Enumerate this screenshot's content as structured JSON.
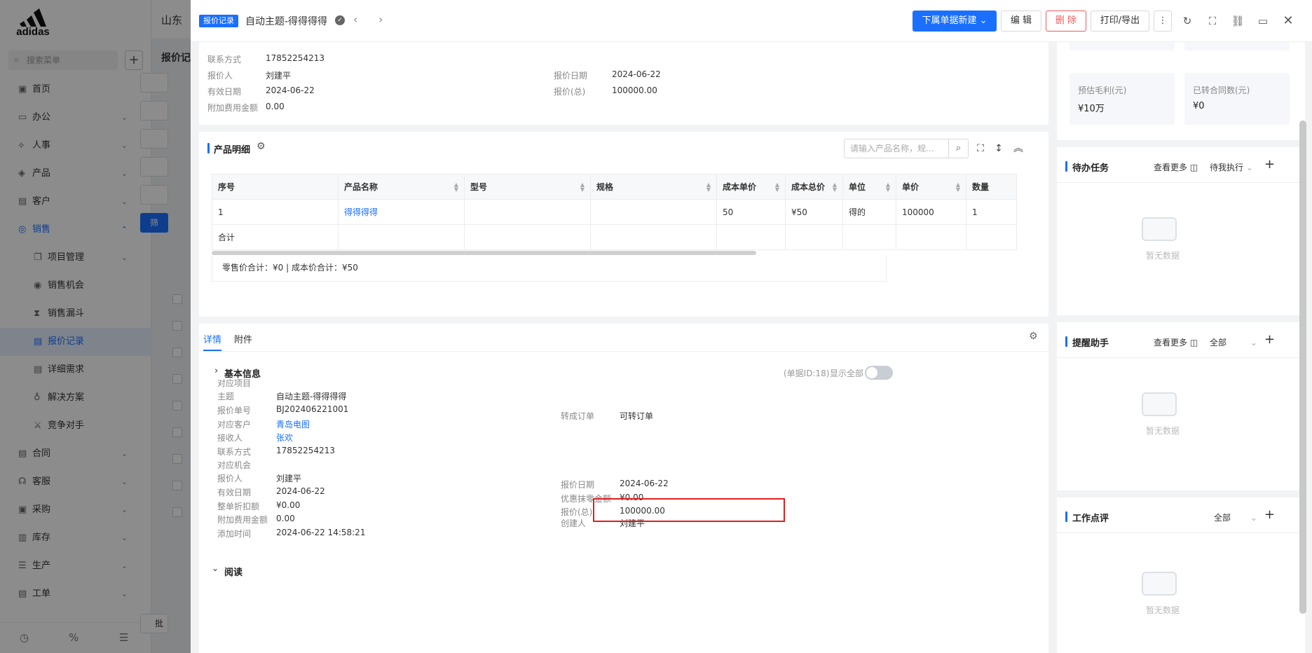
{
  "background": {
    "logo_text": "adidas",
    "search_placeholder": "搜索菜单",
    "company": "山东",
    "page_title": "报价记",
    "filter_label": "筛",
    "batch_label": "批",
    "menu": [
      {
        "label": "首页",
        "icon": "home-icon",
        "glyph": "▣",
        "chevron": ""
      },
      {
        "label": "办公",
        "icon": "office-icon",
        "glyph": "▭",
        "chevron": "⌄"
      },
      {
        "label": "人事",
        "icon": "people-icon",
        "glyph": "⟡",
        "chevron": "⌄"
      },
      {
        "label": "产品",
        "icon": "cube-icon",
        "glyph": "◈",
        "chevron": "⌄"
      },
      {
        "label": "客户",
        "icon": "customer-icon",
        "glyph": "▤",
        "chevron": "⌄"
      },
      {
        "label": "销售",
        "icon": "sales-icon",
        "glyph": "◎",
        "chevron": "⌃"
      },
      {
        "label": "项目管理",
        "icon": "project-icon",
        "glyph": "❐",
        "chevron": "⌄"
      },
      {
        "label": "销售机会",
        "icon": "opportunity-icon",
        "glyph": "◉",
        "chevron": ""
      },
      {
        "label": "销售漏斗",
        "icon": "funnel-icon",
        "glyph": "⧗",
        "chevron": ""
      },
      {
        "label": "报价记录",
        "icon": "quote-icon",
        "glyph": "▤",
        "chevron": ""
      },
      {
        "label": "详细需求",
        "icon": "requirement-icon",
        "glyph": "▤",
        "chevron": ""
      },
      {
        "label": "解决方案",
        "icon": "solution-icon",
        "glyph": "♁",
        "chevron": ""
      },
      {
        "label": "竞争对手",
        "icon": "competitor-icon",
        "glyph": "⚔",
        "chevron": ""
      },
      {
        "label": "合同",
        "icon": "contract-icon",
        "glyph": "▤",
        "chevron": "⌄"
      },
      {
        "label": "客服",
        "icon": "service-icon",
        "glyph": "☊",
        "chevron": "⌄"
      },
      {
        "label": "采购",
        "icon": "purchase-icon",
        "glyph": "▣",
        "chevron": "⌄"
      },
      {
        "label": "库存",
        "icon": "inventory-icon",
        "glyph": "▥",
        "chevron": "⌄"
      },
      {
        "label": "生产",
        "icon": "production-icon",
        "glyph": "☰",
        "chevron": "⌄"
      },
      {
        "label": "工单",
        "icon": "workorder-icon",
        "glyph": "▤",
        "chevron": "⌄"
      }
    ]
  },
  "drawer": {
    "tag": "报价记录",
    "title": "自动主题-得得得得",
    "buttons": {
      "new_sub": "下属单据新建 ⌄",
      "edit": "编 辑",
      "delete": "删 除",
      "print": "打印/导出"
    },
    "summary": {
      "contact_label": "联系方式",
      "contact_value": "17852254213",
      "quoter_label": "报价人",
      "quoter_value": "刘建平",
      "quote_date_label": "报价日期",
      "quote_date_value": "2024-06-22",
      "valid_label": "有效日期",
      "valid_value": "2024-06-22",
      "total_label": "报价(总)",
      "total_value": "100000.00",
      "extra_label": "附加费用金额",
      "extra_value": "0.00"
    },
    "products": {
      "title": "产品明细",
      "search_placeholder": "请输入产品名称，规...",
      "columns": [
        "序号",
        "产品名称",
        "型号",
        "规格",
        "成本单价",
        "成本总价",
        "单位",
        "单价",
        "数量"
      ],
      "rows": [
        [
          "1",
          "得得得得",
          "",
          "",
          "50",
          "¥50",
          "得的",
          "100000",
          "1"
        ]
      ],
      "total_row_label": "合计",
      "footer": "零售价合计：¥0 |   成本价合计：¥50"
    },
    "detail": {
      "tabs": [
        "详情",
        "附件"
      ],
      "basic_title": "基本信息",
      "doc_id": "(单据ID:18)",
      "show_all": "显示全部",
      "left_fields": [
        {
          "label": "对应项目",
          "value": "",
          "link": false
        },
        {
          "label": "主题",
          "value": "自动主题-得得得得",
          "link": false
        },
        {
          "label": "报价单号",
          "value": "BJ202406221001",
          "link": false
        },
        {
          "label": "对应客户",
          "value": "青岛电图",
          "link": true
        },
        {
          "label": "接收人",
          "value": "张欢",
          "link": true
        },
        {
          "label": "联系方式",
          "value": "17852254213",
          "link": false
        },
        {
          "label": "对应机会",
          "value": "",
          "link": false
        },
        {
          "label": "报价人",
          "value": "刘建平",
          "link": false
        },
        {
          "label": "有效日期",
          "value": "2024-06-22",
          "link": false
        },
        {
          "label": "整单折扣额",
          "value": "¥0.00",
          "link": false
        },
        {
          "label": "附加费用金额",
          "value": "0.00",
          "link": false
        },
        {
          "label": "添加时间",
          "value": "2024-06-22 14:58:21",
          "link": false
        }
      ],
      "right_fields": {
        "convert_label": "转成订单",
        "convert_value": "可转订单",
        "quote_date_label": "报价日期",
        "quote_date_value": "2024-06-22",
        "discount_label": "优惠抹零金额",
        "discount_value": "¥0.00",
        "total_label": "报价(总)",
        "total_value": "100000.00",
        "creator_label": "创建人",
        "creator_value": "刘建平"
      },
      "read_title": "阅读"
    }
  },
  "side_panel": {
    "stats": [
      {
        "label": "预估毛利(元)",
        "value": "¥10万"
      },
      {
        "label": "已转合同数(元)",
        "value": "¥0"
      }
    ],
    "todo": {
      "title": "待办任务",
      "more": "查看更多",
      "filter": "待我执行",
      "empty": "暂无数据"
    },
    "reminder": {
      "title": "提醒助手",
      "more": "查看更多",
      "filter": "全部",
      "empty": "暂无数据"
    },
    "review": {
      "title": "工作点评",
      "filter": "全部",
      "empty": "暂无数据"
    }
  },
  "colors": {
    "accent": "#1a6fff",
    "danger": "#f25a5a",
    "highlight": "#e01e1e"
  }
}
